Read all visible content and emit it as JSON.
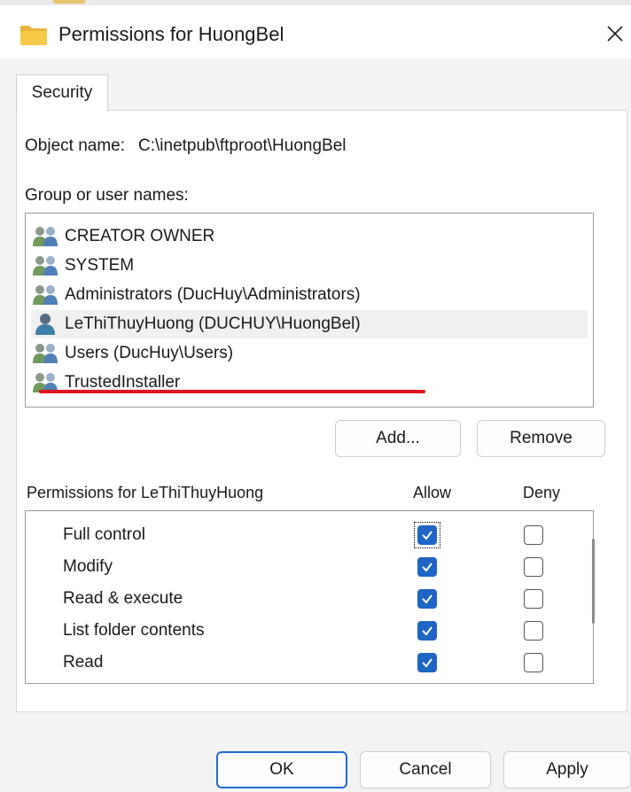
{
  "window": {
    "title": "Permissions for HuongBel"
  },
  "tabs": [
    {
      "label": "Security",
      "selected": true
    }
  ],
  "object": {
    "label": "Object name:",
    "value": "C:\\inetpub\\ftproot\\HuongBel"
  },
  "groups": {
    "label": "Group or user names:",
    "items": [
      {
        "name": "CREATOR OWNER",
        "icon": "group-users-icon"
      },
      {
        "name": "SYSTEM",
        "icon": "group-users-icon"
      },
      {
        "name": "Administrators (DucHuy\\Administrators)",
        "icon": "group-users-icon"
      },
      {
        "name": "LeThiThuyHuong (DUCHUY\\HuongBel)",
        "icon": "single-user-icon",
        "selected": true
      },
      {
        "name": "Users (DucHuy\\Users)",
        "icon": "group-users-icon"
      },
      {
        "name": "TrustedInstaller",
        "icon": "group-users-icon"
      }
    ]
  },
  "buttons": {
    "add": "Add...",
    "remove": "Remove",
    "ok": "OK",
    "cancel": "Cancel",
    "apply": "Apply"
  },
  "permissions": {
    "label": "Permissions for LeThiThuyHuong",
    "allow_header": "Allow",
    "deny_header": "Deny",
    "rows": [
      {
        "name": "Full control",
        "allow": true,
        "deny": false
      },
      {
        "name": "Modify",
        "allow": true,
        "deny": false
      },
      {
        "name": "Read & execute",
        "allow": true,
        "deny": false
      },
      {
        "name": "List folder contents",
        "allow": true,
        "deny": false
      },
      {
        "name": "Read",
        "allow": true,
        "deny": false
      },
      {
        "name": "",
        "allow": true,
        "deny": false
      }
    ]
  },
  "colors": {
    "accent": "#1f65c4",
    "annotation_underline": "#e0141c"
  }
}
